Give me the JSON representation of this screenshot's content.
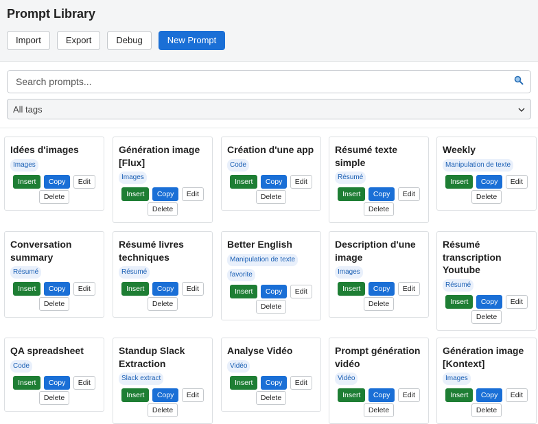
{
  "app": {
    "title": "Prompt Library"
  },
  "toolbar": {
    "import": "Import",
    "export": "Export",
    "debug": "Debug",
    "new_prompt": "New Prompt"
  },
  "search": {
    "placeholder": "Search prompts..."
  },
  "tags_filter": {
    "selected": "All tags"
  },
  "actions": {
    "insert": "Insert",
    "copy": "Copy",
    "edit": "Edit",
    "delete": "Delete"
  },
  "prompts": [
    {
      "title": "Idées d'images",
      "tags": [
        "Images"
      ]
    },
    {
      "title": "Génération image [Flux]",
      "tags": [
        "Images"
      ]
    },
    {
      "title": "Création d'une app",
      "tags": [
        "Code"
      ]
    },
    {
      "title": "Résumé texte simple",
      "tags": [
        "Résumé"
      ]
    },
    {
      "title": "Weekly",
      "tags": [
        "Manipulation de texte"
      ]
    },
    {
      "title": "Conversation summary",
      "tags": [
        "Résumé"
      ]
    },
    {
      "title": "Résumé livres techniques",
      "tags": [
        "Résumé"
      ]
    },
    {
      "title": "Better English",
      "tags": [
        "Manipulation de texte",
        "favorite"
      ]
    },
    {
      "title": "Description d'une image",
      "tags": [
        "Images"
      ]
    },
    {
      "title": "Résumé transcription Youtube",
      "tags": [
        "Résumé"
      ]
    },
    {
      "title": "QA spreadsheet",
      "tags": [
        "Code"
      ]
    },
    {
      "title": "Standup Slack Extraction",
      "tags": [
        "Slack extract"
      ]
    },
    {
      "title": "Analyse Vidéo",
      "tags": [
        "Vidéo"
      ]
    },
    {
      "title": "Prompt génération vidéo",
      "tags": [
        "Vidéo"
      ]
    },
    {
      "title": "Génération image [Kontext]",
      "tags": [
        "Images"
      ]
    }
  ]
}
